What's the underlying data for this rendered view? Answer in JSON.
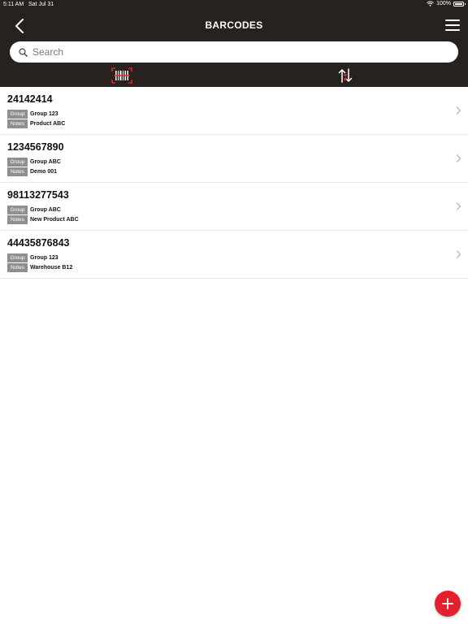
{
  "status_bar": {
    "time": "5:11 AM",
    "date": "Sat Jul 31",
    "battery_text": "100%",
    "battery_level": 1.0
  },
  "header": {
    "title": "BARCODES",
    "back_icon": "chevron-left-icon",
    "menu_icon": "hamburger-menu-icon"
  },
  "search": {
    "placeholder": "Search",
    "value": "",
    "icon": "search-icon"
  },
  "toolbar": {
    "barcode_icon": "barcode-icon",
    "sort_icon": "sort-icon",
    "accent_color": "#e4202e"
  },
  "labels": {
    "group": "Group",
    "notes": "Notes"
  },
  "items": [
    {
      "code": "24142414",
      "group": "Group 123",
      "notes": "Product ABC"
    },
    {
      "code": "1234567890",
      "group": "Group ABC",
      "notes": "Demo 001"
    },
    {
      "code": "98113277543",
      "group": "Group ABC",
      "notes": "New Product ABC"
    },
    {
      "code": "44435876843",
      "group": "Group 123",
      "notes": "Warehouse B12"
    }
  ],
  "fab": {
    "icon": "plus-icon",
    "color": "#e4202e"
  },
  "colors": {
    "header_bg": "#272120",
    "tag_bg": "#8f8f8f"
  }
}
